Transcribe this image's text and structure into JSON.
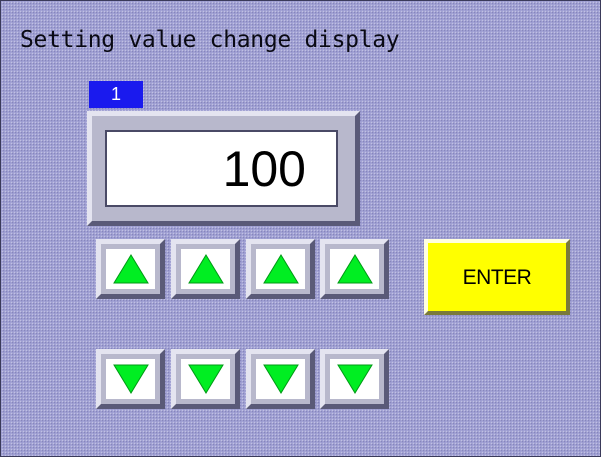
{
  "screen": {
    "title": "Setting value change display"
  },
  "display": {
    "digit_badge": "1",
    "value": "100"
  },
  "keys": {
    "up": [
      {
        "icon": "up-arrow-icon",
        "digit": 1
      },
      {
        "icon": "up-arrow-icon",
        "digit": 2
      },
      {
        "icon": "up-arrow-icon",
        "digit": 3
      },
      {
        "icon": "up-arrow-icon",
        "digit": 4
      }
    ],
    "down": [
      {
        "icon": "down-arrow-icon",
        "digit": 1
      },
      {
        "icon": "down-arrow-icon",
        "digit": 2
      },
      {
        "icon": "down-arrow-icon",
        "digit": 3
      },
      {
        "icon": "down-arrow-icon",
        "digit": 4
      }
    ],
    "enter_label": "ENTER"
  },
  "colors": {
    "background": "#9f9fd3",
    "badge": "#1a1aee",
    "arrow": "#00ee22",
    "enter": "#ffff00"
  }
}
